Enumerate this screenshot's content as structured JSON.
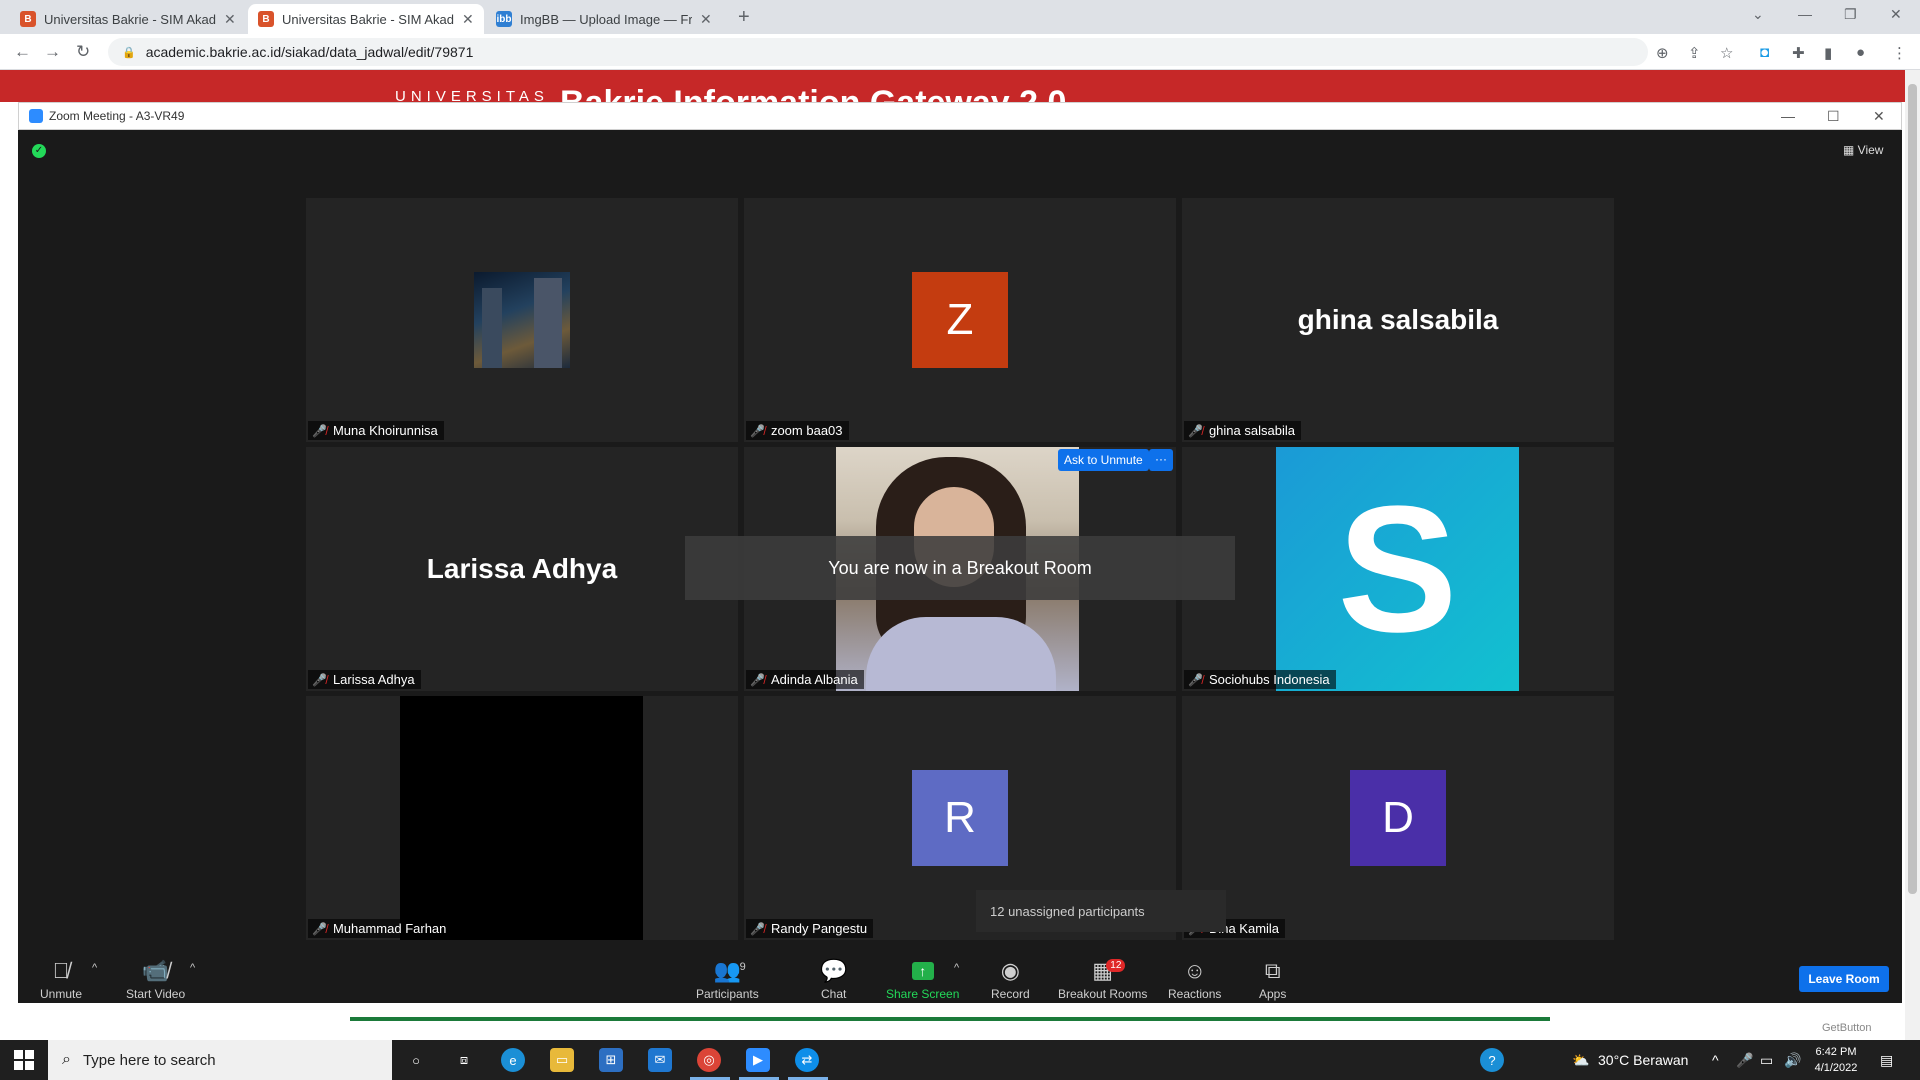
{
  "browser": {
    "tabs": [
      {
        "title": "Universitas Bakrie - SIM Akademik",
        "active": false
      },
      {
        "title": "Universitas Bakrie - SIM Akademik",
        "active": true
      },
      {
        "title": "ImgBB — Upload Image — Free",
        "active": false
      }
    ],
    "url": "academic.bakrie.ac.id/siakad/data_jadwal/edit/79871"
  },
  "page_behind": {
    "header_left": "UNIVERSITAS",
    "header_right": "Bakrie Information Gateway 2.0",
    "getbutton": "GetButton"
  },
  "zoom": {
    "window_title": "Zoom Meeting - A3-VR49",
    "view_label": "View",
    "participants": [
      {
        "name": "Muna Khoirunnisa",
        "display": "photo"
      },
      {
        "name": "zoom baa03",
        "display": "avatar",
        "initial": "Z",
        "color": "#c43c10"
      },
      {
        "name": "ghina salsabila",
        "display": "name"
      },
      {
        "name": "Larissa Adhya",
        "display": "name"
      },
      {
        "name": "Adinda Albania",
        "display": "photo"
      },
      {
        "name": "Sociohubs Indonesia",
        "display": "logo",
        "initial": "S"
      },
      {
        "name": "Muhammad Farhan",
        "display": "black"
      },
      {
        "name": "Randy Pangestu",
        "display": "avatar",
        "initial": "R",
        "color": "#5e6bc4"
      },
      {
        "name": "Dina Kamila",
        "display": "avatar",
        "initial": "D",
        "color": "#4a2fa8"
      }
    ],
    "ask_to_unmute": "Ask to Unmute",
    "more": "···",
    "toast": "You are now in a Breakout Room",
    "unassigned": "12 unassigned participants",
    "controls": {
      "unmute": "Unmute",
      "start_video": "Start Video",
      "participants": "Participants",
      "participants_count": "9",
      "chat": "Chat",
      "share_screen": "Share Screen",
      "record": "Record",
      "breakout_rooms": "Breakout Rooms",
      "breakout_badge": "12",
      "reactions": "Reactions",
      "apps": "Apps",
      "leave_room": "Leave Room"
    }
  },
  "taskbar": {
    "search_placeholder": "Type here to search",
    "weather": "30°C  Berawan",
    "time": "6:42 PM",
    "date": "4/1/2022"
  }
}
